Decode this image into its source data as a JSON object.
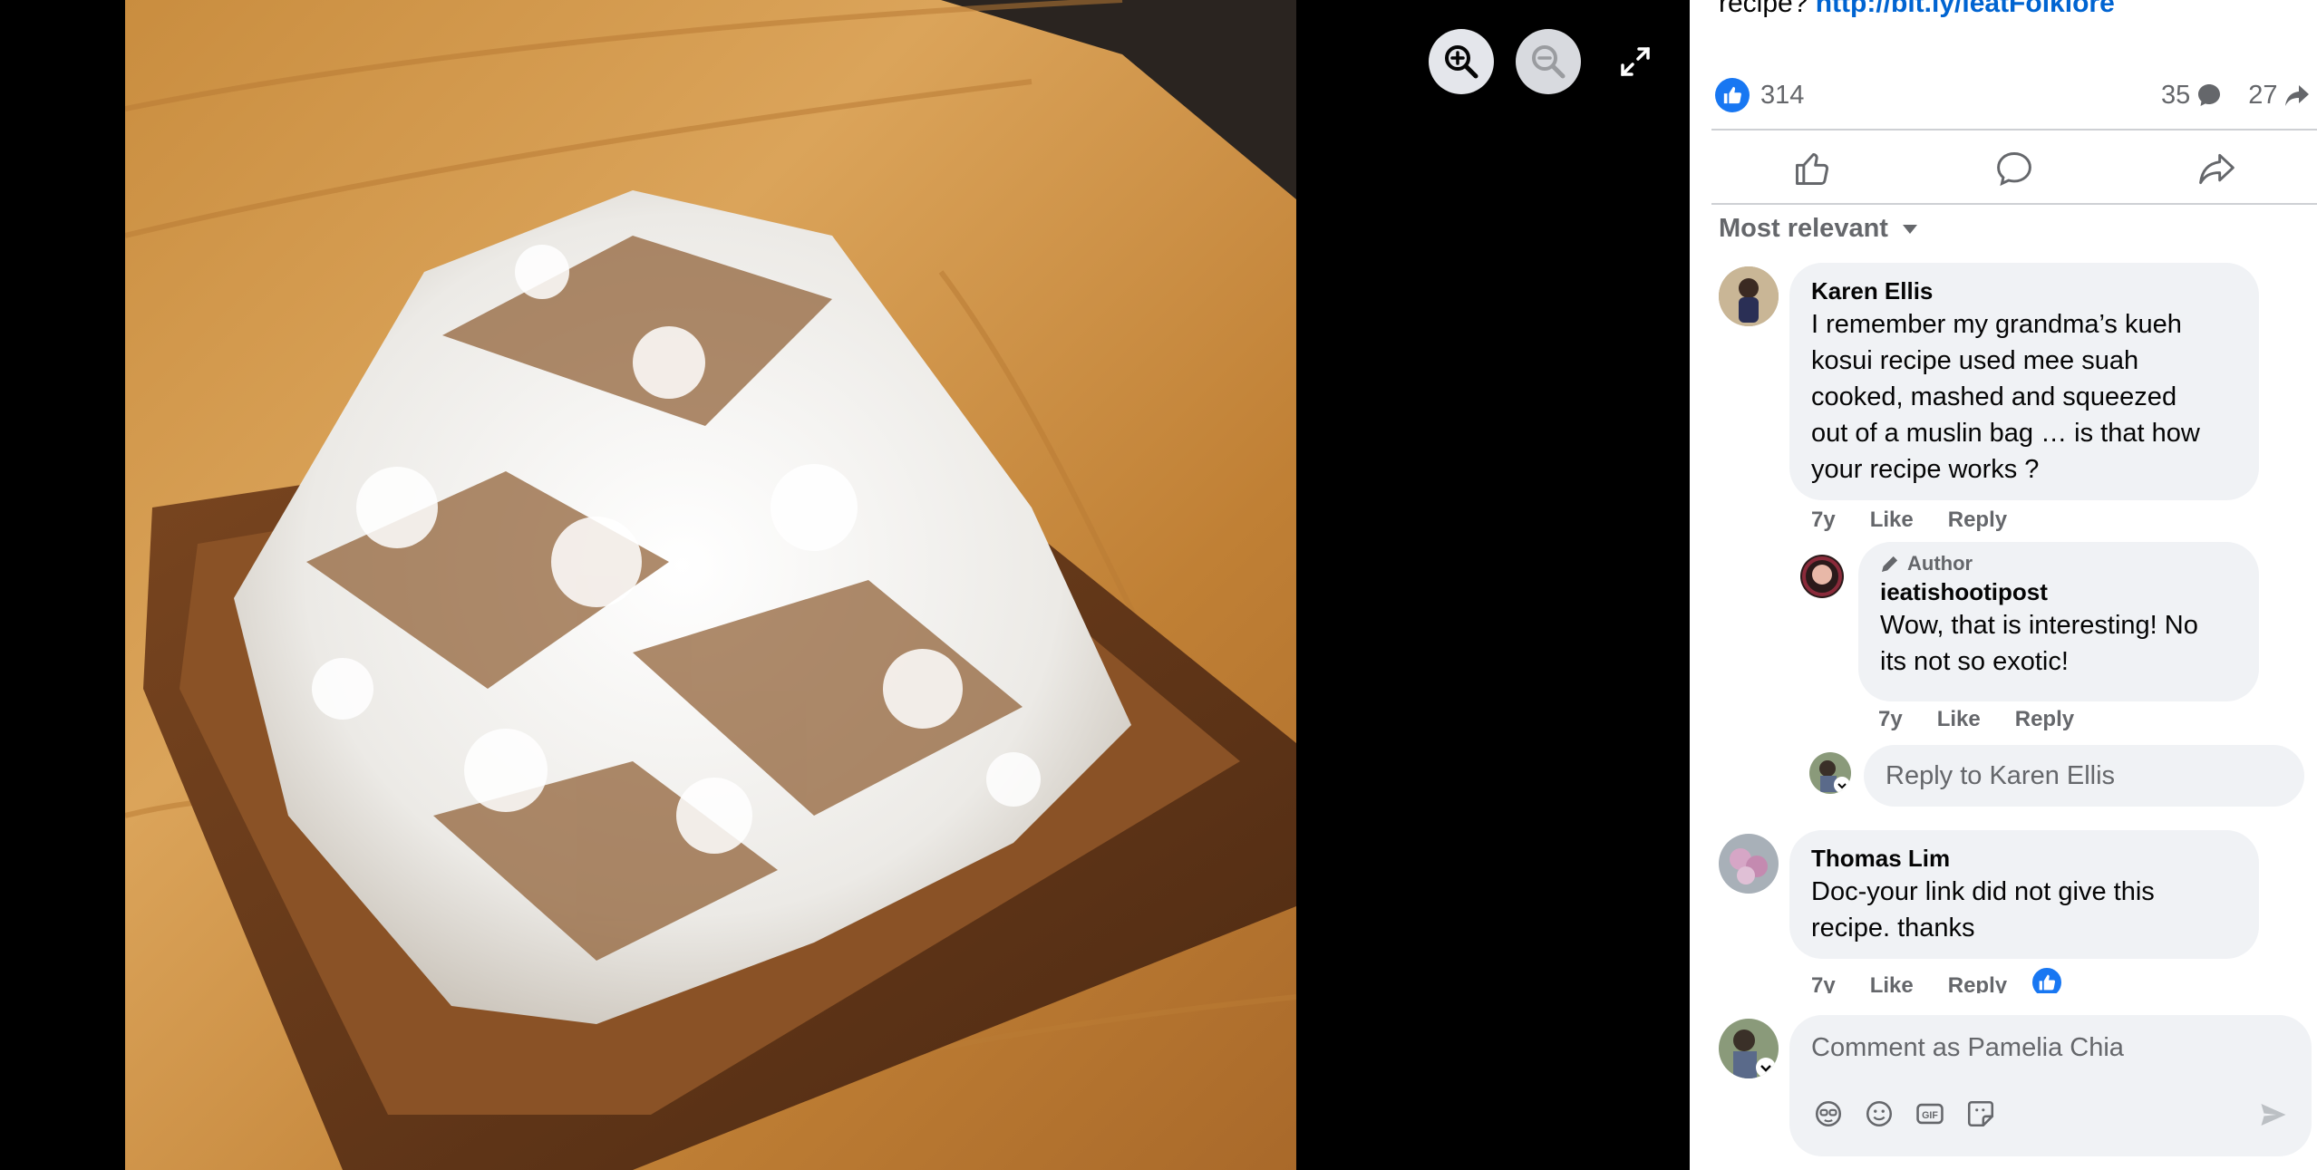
{
  "post": {
    "text_prefix": "recipe? ",
    "link_text": "http://bit.ly/ieatFolklore"
  },
  "stats": {
    "reactions": "314",
    "comments": "35",
    "shares": "27"
  },
  "sort": {
    "label": "Most relevant"
  },
  "comments": [
    {
      "name": "Karen Ellis",
      "text": "I remember my grandma’s kueh kosui recipe used mee suah cooked, mashed and squeezed out of a muslin bag … is that how your recipe works ?",
      "lines": [
        "I remember my grandma’s kueh",
        "kosui recipe used mee suah",
        "cooked, mashed and squeezed",
        "out of a muslin bag … is that how",
        "your recipe works ?"
      ],
      "age": "7y",
      "like": "Like",
      "reply": "Reply"
    },
    {
      "badge": "Author",
      "name": "ieatishootipost",
      "lines": [
        "Wow, that is interesting! No",
        "its not so exotic!"
      ],
      "age": "7y",
      "like": "Like",
      "reply": "Reply"
    },
    {
      "name": "Thomas Lim",
      "lines": [
        "Doc-your link did not give this",
        "recipe. thanks"
      ],
      "age": "7y",
      "like": "Like",
      "reply": "Reply"
    }
  ],
  "reply_box": {
    "placeholder": "Reply to Karen Ellis"
  },
  "composer": {
    "placeholder": "Comment as Pamelia Chia"
  },
  "colors": {
    "accent": "#1877f2",
    "link": "#0064d1",
    "bubble": "#f0f2f5",
    "muted": "#65676b"
  }
}
